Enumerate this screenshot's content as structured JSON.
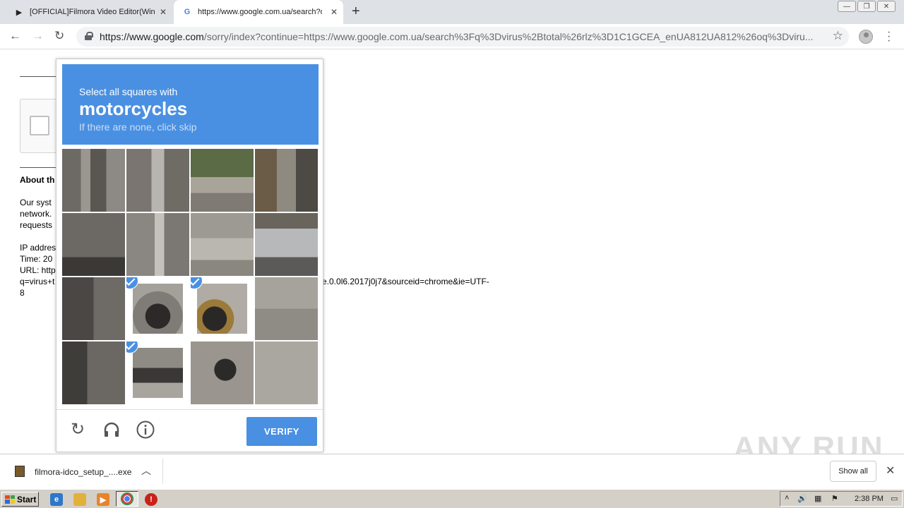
{
  "browser": {
    "tabs": [
      {
        "label": "[OFFICIAL]Filmora Video Editor(Wind",
        "icon": "filmora-icon"
      },
      {
        "label": "https://www.google.com.ua/search?q",
        "icon": "google-icon"
      }
    ],
    "address": {
      "host": "https://www.google.com",
      "path": "/sorry/index?continue=https://www.google.com.ua/search%3Fq%3Dvirus%2Btotal%26rlz%3D1C1GCEA_enUA812UA812%26oq%3Dviru..."
    }
  },
  "page": {
    "about_heading": "About th",
    "lines": [
      "Our syst",
      "network.",
      "requests",
      "",
      "IP addres",
      "Time: 20",
      "URL: http",
      "q=virus+t",
      "8"
    ],
    "url_tail": "e.0.0l6.2017j0j7&sourceid=chrome&ie=UTF-"
  },
  "captcha": {
    "line1": "Select all squares with",
    "target": "motorcycles",
    "line3": "If there are none, click skip",
    "verify_label": "VERIFY",
    "selected_tiles": [
      9,
      10,
      13
    ]
  },
  "downloads": {
    "file": "filmora-idco_setup_....exe",
    "show_all": "Show all"
  },
  "taskbar": {
    "start_label": "Start",
    "clock": "2:38 PM"
  },
  "watermark": "ANY RUN",
  "colors": {
    "accent": "#4a90e2"
  }
}
